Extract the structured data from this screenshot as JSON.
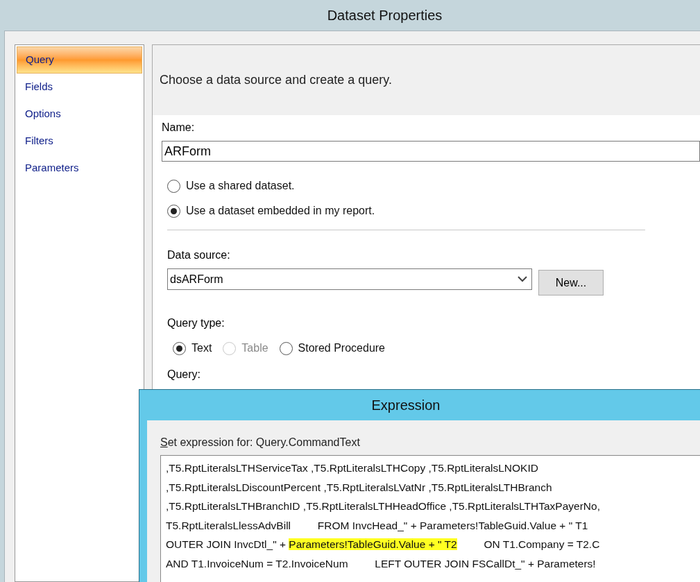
{
  "window": {
    "title": "Dataset Properties"
  },
  "sidebar": {
    "items": [
      {
        "label": "Query",
        "selected": true
      },
      {
        "label": "Fields",
        "selected": false
      },
      {
        "label": "Options",
        "selected": false
      },
      {
        "label": "Filters",
        "selected": false
      },
      {
        "label": "Parameters",
        "selected": false
      }
    ]
  },
  "header": "Choose a data source and create a query.",
  "name": {
    "label": "Name:",
    "value": "ARForm"
  },
  "dataset_options": [
    {
      "label": "Use a shared dataset.",
      "selected": false
    },
    {
      "label": "Use a dataset embedded in my report.",
      "selected": true
    }
  ],
  "data_source": {
    "label": "Data source:",
    "value": "dsARForm",
    "new_button": "New..."
  },
  "query_type": {
    "label": "Query type:",
    "options": [
      {
        "label": "Text",
        "selected": true,
        "disabled": false
      },
      {
        "label": "Table",
        "selected": false,
        "disabled": true
      },
      {
        "label": "Stored Procedure",
        "selected": false,
        "disabled": false
      }
    ]
  },
  "query_label": "Query:",
  "expression": {
    "title": "Expression",
    "label_accel": "S",
    "label": "et expression for: Query.CommandText",
    "lines": [
      [
        {
          "text": ",T5.RptLiteralsLTHServiceTax ,T5.RptLiteralsLTHCopy ,T5.RptLiteralsLNOKID",
          "highlighted": false
        }
      ],
      [
        {
          "text": ",T5.RptLiteralsLDiscountPercent ,T5.RptLiteralsLVatNr ,T5.RptLiteralsLTHBranch",
          "highlighted": false
        }
      ],
      [
        {
          "text": ",T5.RptLiteralsLTHBranchID ,T5.RptLiteralsLTHHeadOffice ,T5.RptLiteralsLTHTaxPayerNo,",
          "highlighted": false
        }
      ],
      [
        {
          "text": "T5.RptLiteralsLlessAdvBill         FROM InvcHead_\" + Parameters!TableGuid.Value + \" T1",
          "highlighted": false
        }
      ],
      [
        {
          "text": "OUTER JOIN InvcDtl_\" + ",
          "highlighted": false
        },
        {
          "text": "Parameters!TableGuid.Value + \" T2",
          "highlighted": true
        },
        {
          "text": "         ON T1.Company = T2.C",
          "highlighted": false
        }
      ],
      [
        {
          "text": "AND T1.InvoiceNum = T2.InvoiceNum         LEFT OUTER JOIN FSCallDt_\" + Parameters!",
          "highlighted": false
        }
      ]
    ]
  }
}
